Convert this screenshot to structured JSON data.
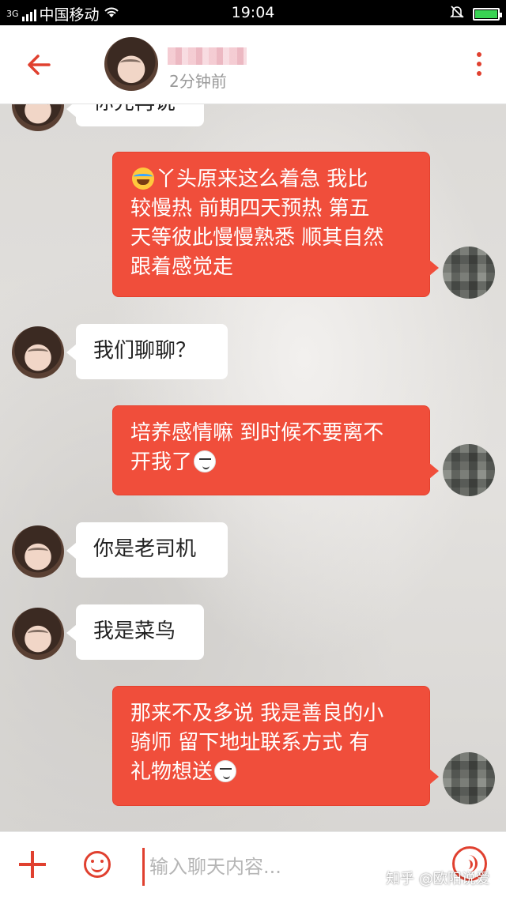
{
  "status_bar": {
    "carrier": "中国移动",
    "network": "3G",
    "time": "19:04"
  },
  "header": {
    "subtitle": "2分钟前",
    "back_icon": "arrow-left-icon",
    "more_icon": "more-vertical-icon"
  },
  "messages": [
    {
      "side": "in",
      "text": "你先再说"
    },
    {
      "side": "out",
      "emoji": "laugh-cry",
      "text": "丫头原来这么着急 我比较慢热 前期四天预热 第五天等彼此慢慢熟悉 顺其自然 跟着感觉走",
      "lines": [
        "丫头原来这么着急 我比",
        "较慢热 前期四天预热 第五",
        "天等彼此慢慢熟悉 顺其自然",
        "跟着感觉走"
      ]
    },
    {
      "side": "in",
      "text": "我们聊聊？"
    },
    {
      "side": "out",
      "lines": [
        "培养感情嘛 到时候不要离不",
        "开我了"
      ],
      "emoji_end": "smirk"
    },
    {
      "side": "in",
      "text": "你是老司机"
    },
    {
      "side": "in",
      "text": "我是菜鸟"
    },
    {
      "side": "out",
      "lines": [
        "那来不及多说 我是善良的小",
        "骑师 留下地址联系方式 有",
        "礼物想送"
      ],
      "emoji_end": "smirk"
    }
  ],
  "input_bar": {
    "placeholder": "输入聊天内容...",
    "plus_icon": "plus-icon",
    "emoji_icon": "smiley-icon",
    "voice_icon": "voice-icon"
  },
  "watermark": "知乎 @欧阳说爱",
  "colors": {
    "accent": "#e0402f",
    "bubble_out": "#f04e3b",
    "bubble_in": "#ffffff"
  }
}
